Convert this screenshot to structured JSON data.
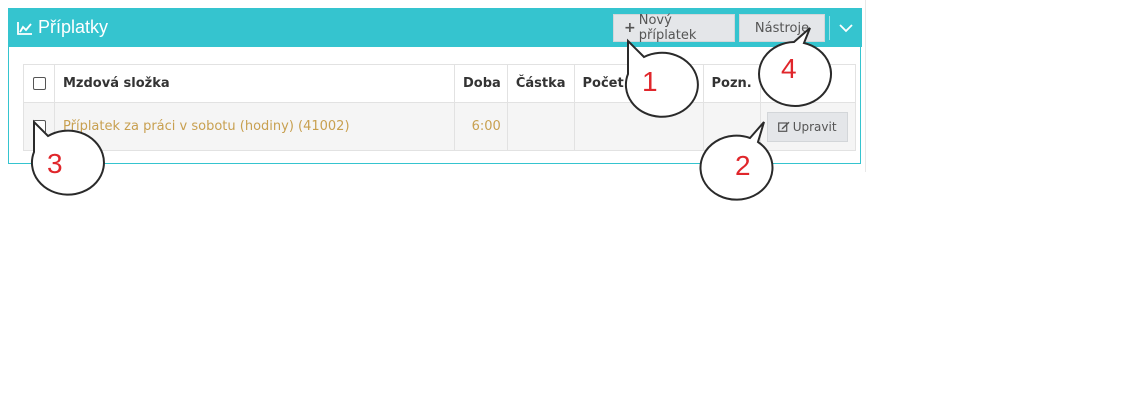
{
  "panel": {
    "title": "Příplatky",
    "title_icon": "line-chart-icon",
    "accent_color": "#35c4cf",
    "buttons": {
      "new_label": "Nový příplatek",
      "new_icon": "plus-icon",
      "tools_label": "Nástroje"
    },
    "collapse_icon": "chevron-down-icon"
  },
  "table": {
    "columns": [
      "",
      "Mzdová složka",
      "Doba",
      "Částka",
      "Počet",
      "Pozn.",
      ""
    ],
    "rows": [
      {
        "name": "Příplatek za práci v sobotu (hodiny) (41002)",
        "doba": "6:00",
        "castka": "",
        "pocet": "",
        "pozn": "",
        "action_label": "Upravit",
        "action_icon": "edit-icon"
      }
    ],
    "link_color": "#c8a050"
  },
  "annotations": {
    "color": "#e0262b",
    "callouts": [
      "1",
      "2",
      "3",
      "4"
    ]
  }
}
